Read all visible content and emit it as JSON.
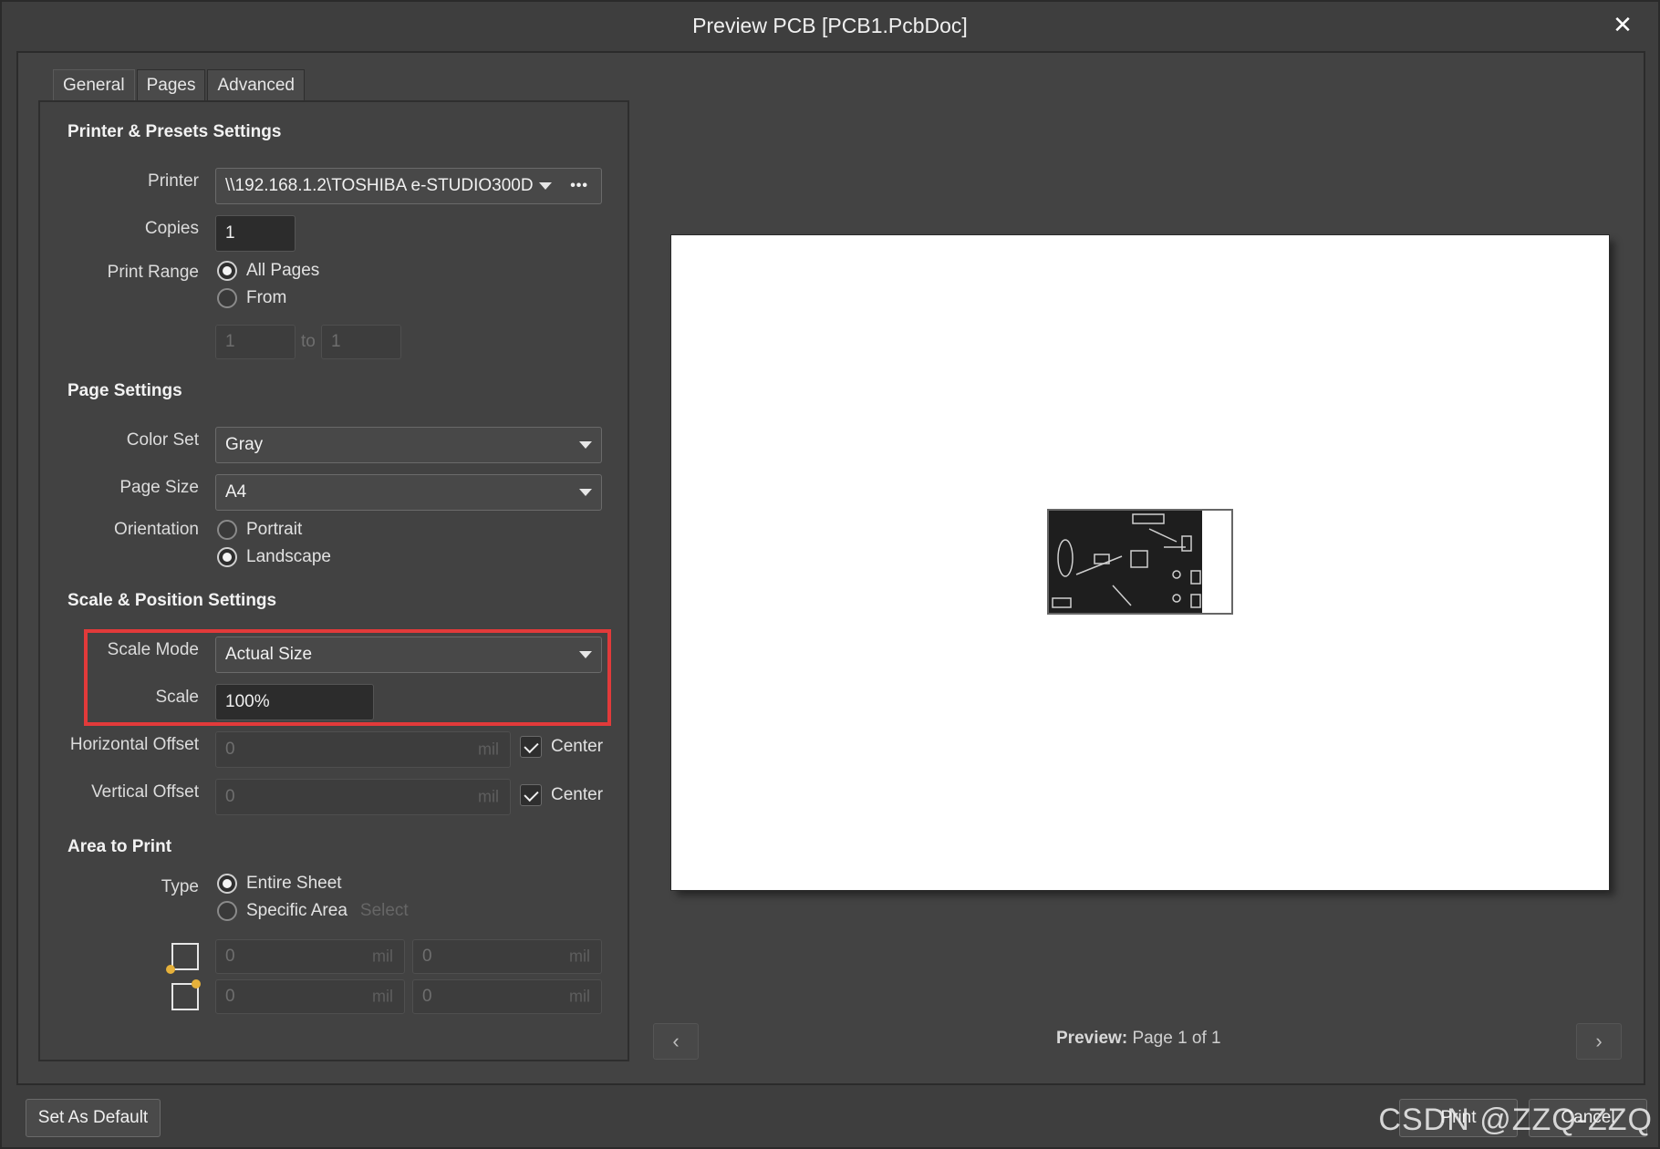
{
  "window": {
    "title": "Preview PCB [PCB1.PcbDoc]",
    "close_glyph": "✕"
  },
  "tabs": [
    {
      "label": "General",
      "active": true
    },
    {
      "label": "Pages",
      "active": false
    },
    {
      "label": "Advanced",
      "active": false
    }
  ],
  "printer_presets": {
    "title": "Printer & Presets Settings",
    "printer_label": "Printer",
    "printer_value": "\\\\192.168.1.2\\TOSHIBA e-STUDIO300D",
    "more_glyph": "•••",
    "copies_label": "Copies",
    "copies_value": "1",
    "print_range_label": "Print Range",
    "range_all": "All Pages",
    "range_from": "From",
    "from_value": "1",
    "to_label": "to",
    "to_value": "1"
  },
  "page_settings": {
    "title": "Page Settings",
    "color_set_label": "Color Set",
    "color_set_value": "Gray",
    "page_size_label": "Page Size",
    "page_size_value": "A4",
    "orientation_label": "Orientation",
    "portrait": "Portrait",
    "landscape": "Landscape"
  },
  "scale_position": {
    "title": "Scale & Position Settings",
    "scale_mode_label": "Scale Mode",
    "scale_mode_value": "Actual Size",
    "scale_label": "Scale",
    "scale_value": "100%",
    "h_offset_label": "Horizontal Offset",
    "h_offset_value": "0",
    "v_offset_label": "Vertical Offset",
    "v_offset_value": "0",
    "unit": "mil",
    "center_label": "Center"
  },
  "area_to_print": {
    "title": "Area to Print",
    "type_label": "Type",
    "entire_sheet": "Entire Sheet",
    "specific_area": "Specific Area",
    "select_link": "Select",
    "x1": "0",
    "y1": "0",
    "x2": "0",
    "y2": "0",
    "unit": "mil"
  },
  "preview": {
    "status_label": "Preview:",
    "status_value": "Page 1 of 1",
    "prev_glyph": "‹",
    "next_glyph": "›"
  },
  "footer": {
    "set_default": "Set As Default",
    "print": "Print",
    "cancel": "Cancel"
  },
  "watermark": "CSDN @ZZQ-ZZQ",
  "colors": {
    "highlight": "#e23a3a",
    "accent_dot": "#e6b13a"
  }
}
